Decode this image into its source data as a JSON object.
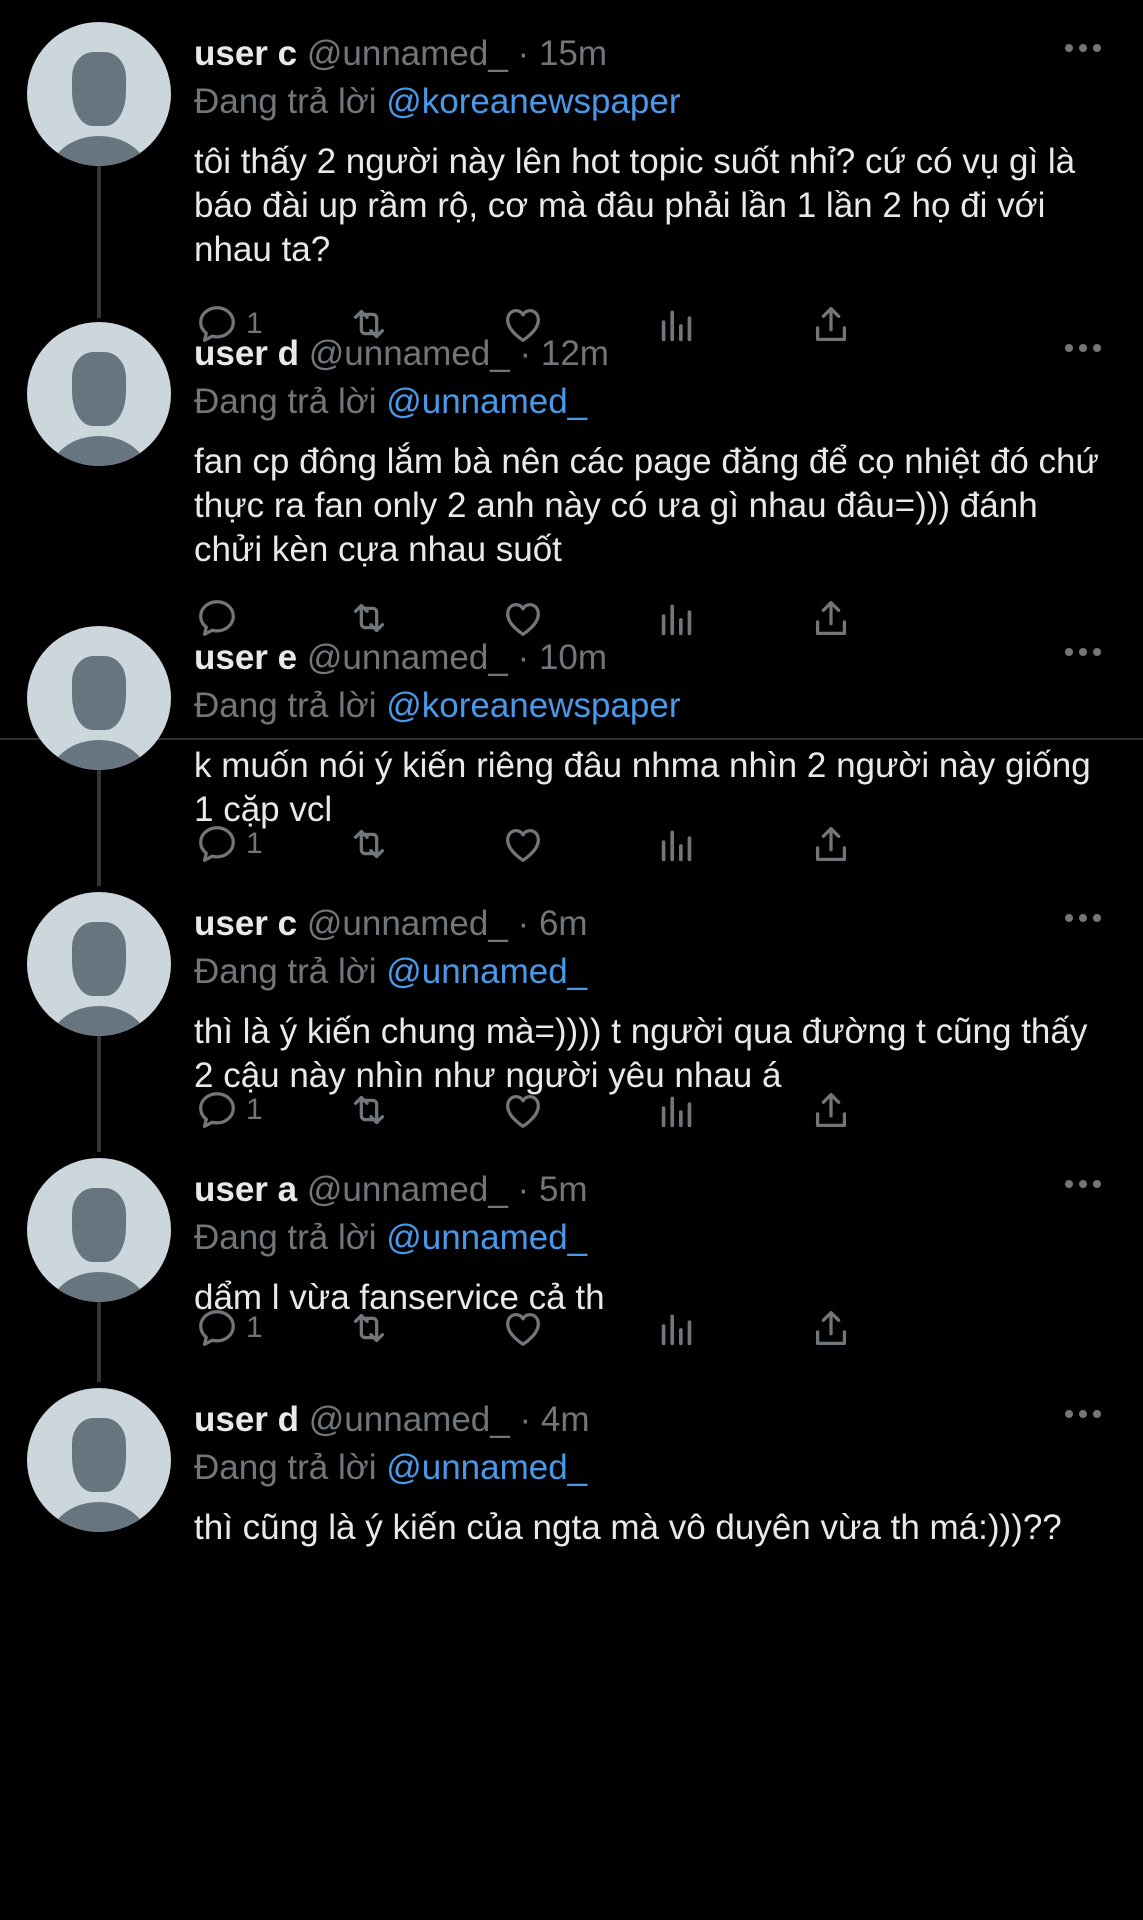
{
  "replying_prefix": "Đang trả lời",
  "tweets": [
    {
      "name": "user c",
      "handle": "@unnamed_",
      "dot": "·",
      "time": "15m",
      "mention": "@koreanewspaper",
      "body": "tôi thấy 2 người này lên hot topic suốt nhỉ? cứ có vụ gì là báo đài up rầm rộ, cơ mà đâu phải lần 1 lần 2 họ đi với nhau ta?",
      "reply_count": "1"
    },
    {
      "name": "user d",
      "handle": "@unnamed_",
      "dot": "·",
      "time": "12m",
      "mention": "@unnamed_",
      "body": "fan cp đông lắm bà nên các page đăng để cọ nhiệt đó chứ thực ra fan only 2 anh này có ưa gì nhau đâu=))) đánh chửi kèn cựa nhau suốt",
      "reply_count": ""
    },
    {
      "name": "user e",
      "handle": "@unnamed_",
      "dot": "·",
      "time": "10m",
      "mention": "@koreanewspaper",
      "body": "k muốn nói ý kiến riêng đâu nhma nhìn 2 người này giống 1 cặp vcl",
      "reply_count": "1"
    },
    {
      "name": "user c",
      "handle": "@unnamed_",
      "dot": "·",
      "time": "6m",
      "mention": "@unnamed_",
      "body": "thì là ý kiến chung mà=)))) t người qua đường t cũng thấy 2 cậu này nhìn như người yêu nhau á",
      "reply_count": "1"
    },
    {
      "name": "user a",
      "handle": "@unnamed_",
      "dot": "·",
      "time": "5m",
      "mention": "@unnamed_",
      "body": "dẩm l vừa fanservice cả th",
      "reply_count": "1"
    },
    {
      "name": "user d",
      "handle": "@unnamed_",
      "dot": "·",
      "time": "4m",
      "mention": "@unnamed_",
      "body": "thì cũng là ý kiến của ngta mà vô duyên vừa th má:)))??",
      "reply_count": ""
    }
  ],
  "icons": [
    "reply-icon",
    "retweet-icon",
    "like-icon",
    "analytics-icon",
    "share-icon",
    "more-icon"
  ],
  "colors": {
    "background": "#000000",
    "text": "#e7e9ea",
    "muted": "#71767b",
    "link": "#4a99e9"
  }
}
